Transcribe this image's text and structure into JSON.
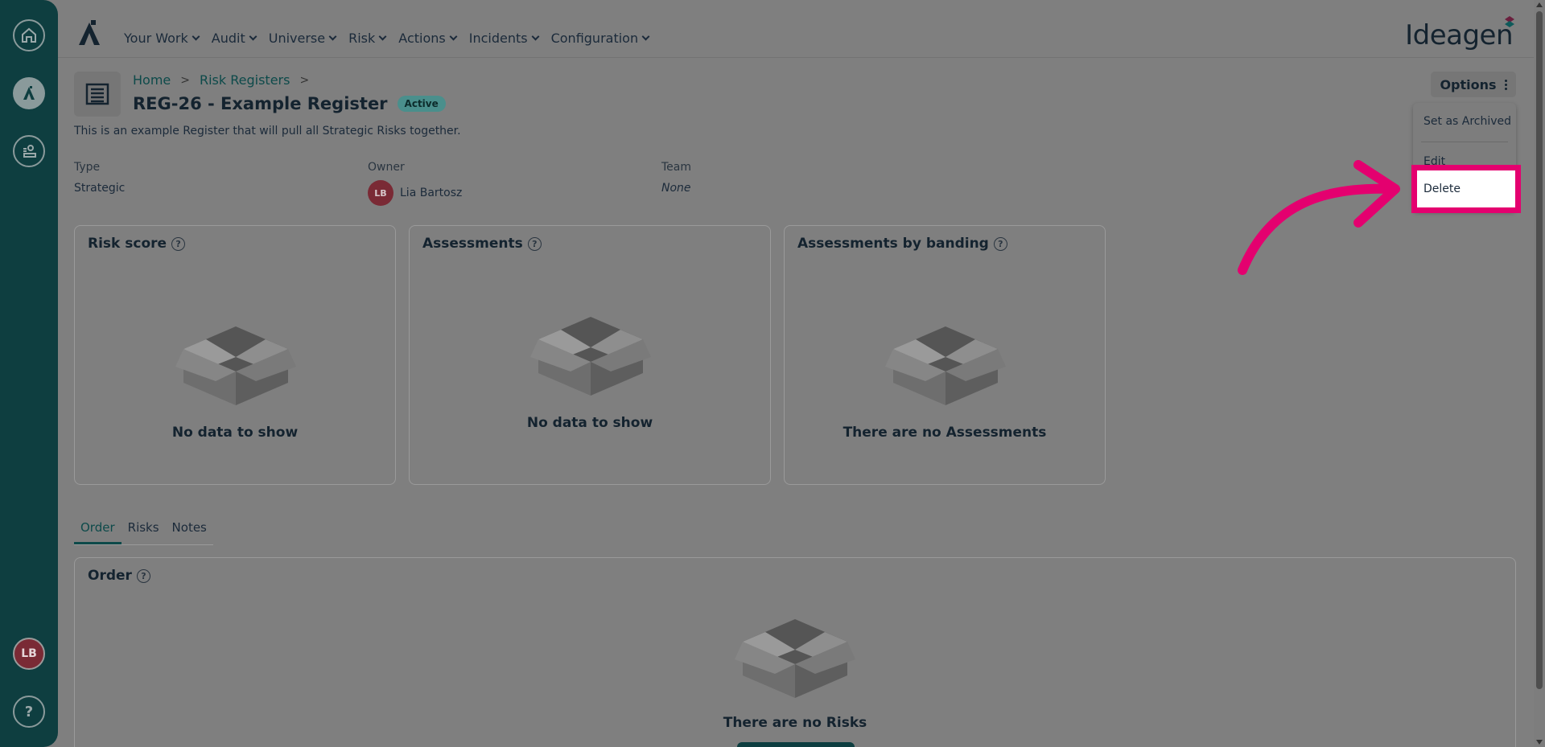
{
  "rail": {
    "avatar_initials": "LB",
    "help_label": "?",
    "icons": [
      "home-icon",
      "app-logo-icon",
      "people-icon"
    ]
  },
  "nav": {
    "items": [
      "Your Work",
      "Audit",
      "Universe",
      "Risk",
      "Actions",
      "Incidents",
      "Configuration"
    ],
    "brand": "Ideagen"
  },
  "breadcrumb": {
    "home": "Home",
    "sep": ">",
    "registers": "Risk Registers"
  },
  "header": {
    "title": "REG-26 - Example Register",
    "status": "Active",
    "description": "This is an example Register that will pull all Strategic Risks together."
  },
  "meta": {
    "type_label": "Type",
    "type_value": "Strategic",
    "owner_label": "Owner",
    "owner_initials": "LB",
    "owner_name": "Lia Bartosz",
    "team_label": "Team",
    "team_value": "None"
  },
  "cards": {
    "risk_score": {
      "title": "Risk score",
      "help": "?",
      "empty": "No data to show"
    },
    "assessments": {
      "title": "Assessments",
      "help": "?",
      "empty": "No data to show"
    },
    "banding": {
      "title": "Assessments by banding",
      "help": "?",
      "empty": "There are no Assessments"
    }
  },
  "tabs": [
    "Order",
    "Risks",
    "Notes"
  ],
  "order_panel": {
    "title": "Order",
    "help": "?",
    "empty": "There are no Risks"
  },
  "options": {
    "label": "Options",
    "menu": [
      "Set as Archived",
      "Edit",
      "Delete"
    ]
  },
  "colors": {
    "rail": "#0e3e40",
    "accent": "#0d4a4a",
    "highlight": "#e4006f",
    "overlay": "#7f7f7f"
  }
}
